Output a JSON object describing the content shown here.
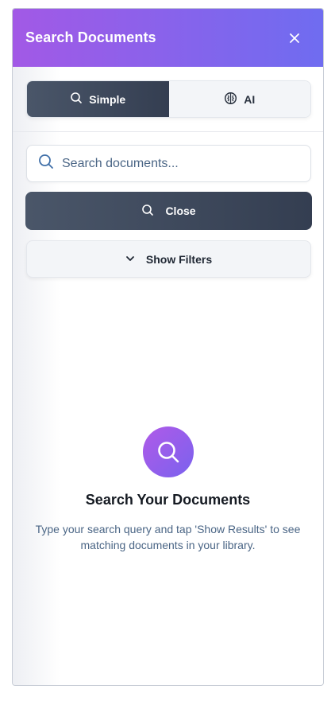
{
  "header": {
    "title": "Search Documents",
    "close_icon": "close-icon"
  },
  "tabs": [
    {
      "label": "Simple",
      "icon": "search-icon",
      "active": true
    },
    {
      "label": "AI",
      "icon": "brain-icon",
      "active": false
    }
  ],
  "search": {
    "value": "",
    "placeholder": "Search documents..."
  },
  "actions": {
    "primary_label": "Close",
    "filters_label": "Show Filters"
  },
  "empty_state": {
    "title": "Search Your Documents",
    "description": "Type your search query and tap 'Show Results' to see matching documents in your library."
  },
  "colors": {
    "header_gradient_start": "#a259e6",
    "header_gradient_end": "#6f6cf0",
    "dark_button": "#3d4759",
    "muted_text": "#4a6585"
  }
}
